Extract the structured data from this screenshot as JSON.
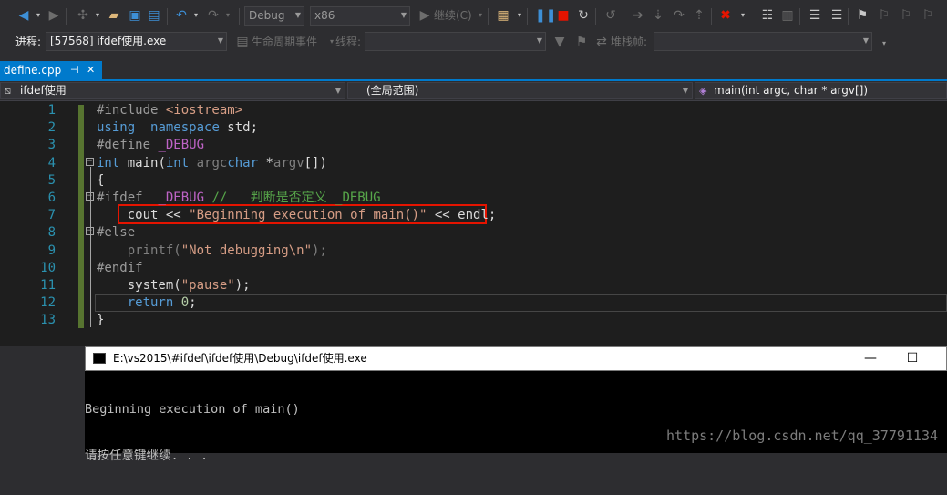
{
  "toolbar": {
    "config_value": "Debug",
    "platform_value": "x86",
    "continue_label": "继续(C)"
  },
  "debug_location": {
    "process_label": "进程:",
    "process_value": "[57568] ifdef使用.exe",
    "lifecycle_label": "生命周期事件",
    "thread_label": "线程:",
    "thread_value": "",
    "stack_label": "堆栈帧:",
    "stack_value": ""
  },
  "tabs": [
    {
      "label": "define.cpp",
      "pin": "⊣",
      "close": "✕"
    }
  ],
  "navigation": {
    "project": "ifdef使用",
    "scope": "(全局范围)",
    "member": "main(int argc, char * argv[])"
  },
  "editor": {
    "line_numbers": [
      "1",
      "2",
      "3",
      "4",
      "5",
      "6",
      "7",
      "8",
      "9",
      "10",
      "11",
      "12",
      "13"
    ],
    "lines": [
      {
        "n": 1,
        "segs": [
          [
            "pp",
            "#include "
          ],
          [
            "inc",
            "<iostream>"
          ]
        ]
      },
      {
        "n": 2,
        "segs": [
          [
            "kw",
            "using"
          ],
          [
            "",
            "  "
          ],
          [
            "kw",
            "namespace"
          ],
          [
            "",
            " std;"
          ]
        ]
      },
      {
        "n": 3,
        "segs": [
          [
            "pp",
            "#define "
          ],
          [
            "macro",
            "_DEBUG"
          ]
        ]
      },
      {
        "n": 4,
        "segs": [
          [
            "kw",
            "int"
          ],
          [
            "",
            " main("
          ],
          [
            "kw",
            "int"
          ],
          [
            "grey",
            " argc"
          ],
          [
            ",  "
          ],
          [
            "kw",
            "char"
          ],
          [
            "",
            " *"
          ],
          [
            "grey",
            "argv"
          ],
          [
            "",
            "[])"
          ]
        ]
      },
      {
        "n": 5,
        "segs": [
          [
            "",
            "{"
          ]
        ]
      },
      {
        "n": 6,
        "segs": [
          [
            "pp",
            "#ifdef  "
          ],
          [
            "macro",
            "_DEBUG"
          ],
          [
            "cmt",
            " //   判断是否定义 _DEBUG"
          ]
        ]
      },
      {
        "n": 7,
        "segs": [
          [
            "",
            "    cout << "
          ],
          [
            "str",
            "\"Beginning execution of main()\""
          ],
          [
            "",
            " << endl;"
          ]
        ]
      },
      {
        "n": 8,
        "segs": [
          [
            "pp",
            "#else"
          ]
        ]
      },
      {
        "n": 9,
        "segs": [
          [
            "grey",
            "    printf("
          ],
          [
            "str",
            "\"Not debugging\\n\""
          ],
          [
            "grey",
            ");"
          ]
        ]
      },
      {
        "n": 10,
        "segs": [
          [
            "pp",
            "#endif"
          ]
        ]
      },
      {
        "n": 11,
        "segs": [
          [
            "",
            "    system("
          ],
          [
            "str",
            "\"pause\""
          ],
          [
            "",
            ");"
          ]
        ]
      },
      {
        "n": 12,
        "segs": [
          [
            "kw",
            "    return"
          ],
          [
            "",
            " "
          ],
          [
            "num",
            "0"
          ],
          [
            "",
            ";"
          ]
        ]
      },
      {
        "n": 13,
        "segs": [
          [
            "",
            "}"
          ]
        ]
      }
    ]
  },
  "console": {
    "title": "E:\\vs2015\\#ifdef\\ifdef使用\\Debug\\ifdef使用.exe",
    "output": [
      "Beginning execution of main()",
      "请按任意键继续. . ."
    ],
    "minimize": "—",
    "maximize": "☐"
  },
  "watermark": "https://blog.csdn.net/qq_37791134",
  "colors": {
    "accent": "#007acc",
    "highlight_box": "#e51400",
    "change_bar": "#577430"
  }
}
